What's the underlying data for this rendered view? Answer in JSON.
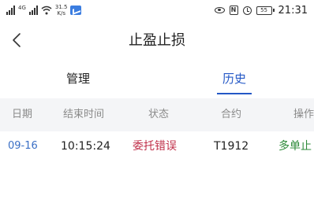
{
  "status_bar": {
    "network_tag": "4G",
    "speed_value": "31.5",
    "speed_unit": "K/s",
    "nfc_label": "N",
    "battery_level": "55",
    "time": "21:31"
  },
  "header": {
    "title": "止盈止损"
  },
  "tabs": [
    {
      "label": "管理",
      "active": false
    },
    {
      "label": "历史",
      "active": true
    }
  ],
  "table": {
    "columns": [
      "日期",
      "结束时间",
      "状态",
      "合约",
      "操作"
    ],
    "rows": [
      {
        "date": "09-16",
        "end_time": "10:15:24",
        "status": "委托错误",
        "contract": "T1912",
        "action": "多单止"
      }
    ]
  },
  "colors": {
    "accent": "#2458c6",
    "date_text": "#3a6fc5",
    "status_error": "#c0304a",
    "action_long": "#2e8b3a",
    "header_bg": "#f4f5f7"
  }
}
